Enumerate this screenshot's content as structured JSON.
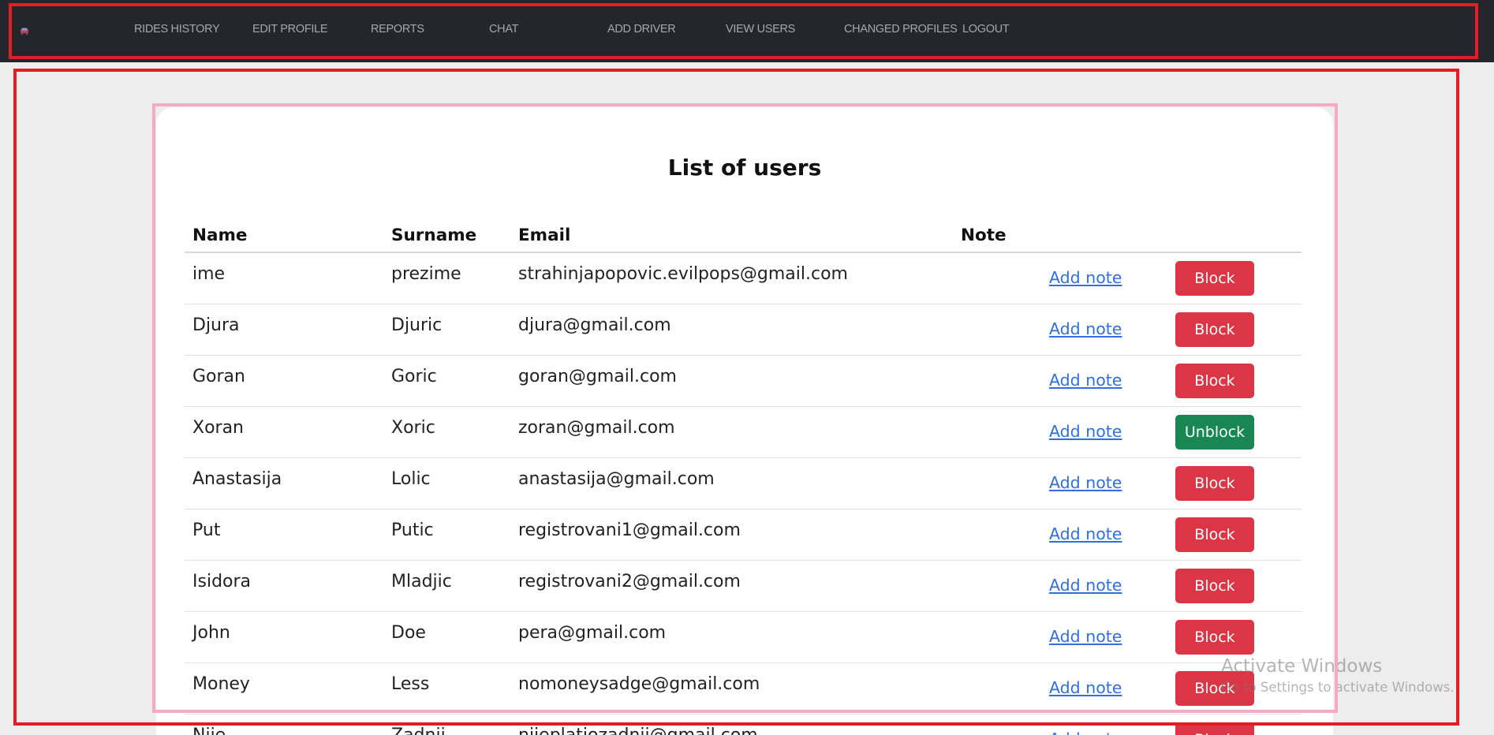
{
  "nav": {
    "items": [
      {
        "label": "RIDES HISTORY",
        "name": "nav-rides-history"
      },
      {
        "label": "EDIT PROFILE",
        "name": "nav-edit-profile"
      },
      {
        "label": "REPORTS",
        "name": "nav-reports"
      },
      {
        "label": "CHAT",
        "name": "nav-chat"
      },
      {
        "label": "ADD DRIVER",
        "name": "nav-add-driver"
      },
      {
        "label": "VIEW USERS",
        "name": "nav-view-users"
      },
      {
        "label": "CHANGED PROFILES",
        "name": "nav-changed-profiles"
      },
      {
        "label": "LOGOUT",
        "name": "nav-logout"
      }
    ]
  },
  "page": {
    "title": "List of users"
  },
  "table": {
    "headers": [
      "Name",
      "Surname",
      "Email",
      "Note"
    ],
    "add_note_label": "Add note",
    "rows": [
      {
        "name": "ime",
        "surname": "prezime",
        "email": "strahinjapopovic.evilpops@gmail.com",
        "action": "Block"
      },
      {
        "name": "Djura",
        "surname": "Djuric",
        "email": "djura@gmail.com",
        "action": "Block"
      },
      {
        "name": "Goran",
        "surname": "Goric",
        "email": "goran@gmail.com",
        "action": "Block"
      },
      {
        "name": "Xoran",
        "surname": "Xoric",
        "email": "zoran@gmail.com",
        "action": "Unblock"
      },
      {
        "name": "Anastasija",
        "surname": "Lolic",
        "email": "anastasija@gmail.com",
        "action": "Block"
      },
      {
        "name": "Put",
        "surname": "Putic",
        "email": "registrovani1@gmail.com",
        "action": "Block"
      },
      {
        "name": "Isidora",
        "surname": "Mladjic",
        "email": "registrovani2@gmail.com",
        "action": "Block"
      },
      {
        "name": "John",
        "surname": "Doe",
        "email": "pera@gmail.com",
        "action": "Block"
      },
      {
        "name": "Money",
        "surname": "Less",
        "email": "nomoneysadge@gmail.com",
        "action": "Block"
      },
      {
        "name": "Nije",
        "surname": "Zadnji",
        "email": "nijeplatiozadnji@gmail.com",
        "action": "Block"
      }
    ]
  },
  "watermark": {
    "line1": "Activate Windows",
    "line2": "Go to Settings to activate Windows."
  },
  "colors": {
    "navbar": "#23272d",
    "block": "#dc3545",
    "unblock": "#198754",
    "link": "#2f6fe0",
    "highlight_red": "#e41c24",
    "highlight_pink": "#f5a9c2"
  }
}
